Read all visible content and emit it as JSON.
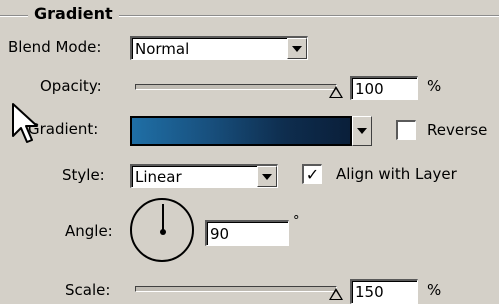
{
  "group": {
    "title": "Gradient"
  },
  "blend_mode": {
    "label": "Blend Mode:",
    "value": "Normal"
  },
  "opacity": {
    "label": "Opacity:",
    "value": "100",
    "unit": "%",
    "level": 1.0
  },
  "gradient": {
    "label": "Gradient:",
    "colors": [
      "#1f6fa6",
      "#0a1f3a"
    ]
  },
  "reverse": {
    "label": "Reverse",
    "checked": false
  },
  "style": {
    "label": "Style:",
    "value": "Linear"
  },
  "align_with_layer": {
    "label": "Align with Layer",
    "checked": true,
    "mark": "✓"
  },
  "angle": {
    "label": "Angle:",
    "value": "90",
    "unit": "°"
  },
  "scale": {
    "label": "Scale:",
    "value": "150",
    "unit": "%",
    "level": 1.0
  },
  "icons": {
    "cursor": "arrow-cursor-icon",
    "dropdown": "chevron-down-icon"
  }
}
